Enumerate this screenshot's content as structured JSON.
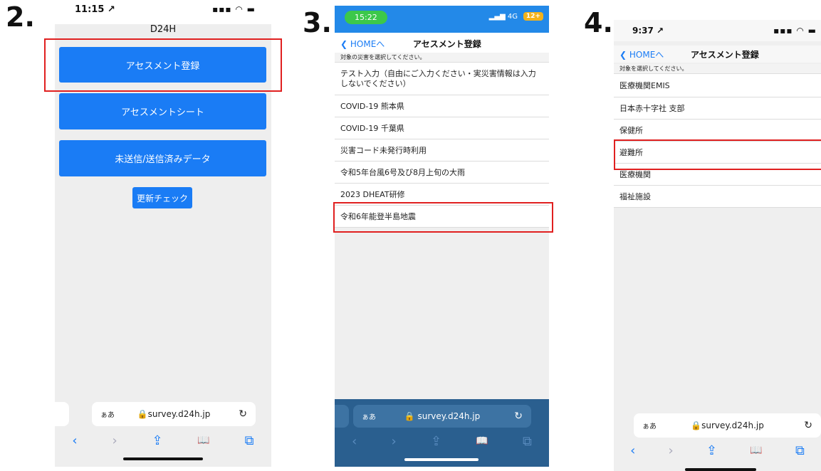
{
  "steps": [
    "2.",
    "3.",
    "4."
  ],
  "screen2": {
    "time": "11:15 ↗",
    "status_icons": "▪▪▪ ◠ ▬",
    "title": "D24H",
    "buttons": [
      "アセスメント登録",
      "アセスメントシート",
      "未送信/送信済みデータ"
    ],
    "update_button": "更新チェック",
    "url_aa": "ぁあ",
    "url": "🔒survey.d24h.jp",
    "reload": "↻",
    "toolbar": [
      "‹",
      "›",
      "⇪",
      "📖",
      "⧉"
    ]
  },
  "screen3": {
    "time": "15:22",
    "status_icons": "▂▄▆ 4G",
    "battery": "12+",
    "back": "❮ HOMEへ",
    "title": "アセスメント登録",
    "hint": "対象の災害を選択してください。",
    "items": [
      "テスト入力（自由にご入力ください・実災害情報は入力しないでください）",
      "COVID-19 熊本県",
      "COVID-19 千葉県",
      "災害コード未発行時利用",
      "令和5年台風6号及び8月上旬の大雨",
      "2023 DHEAT研修",
      "令和6年能登半島地震"
    ],
    "url_aa": "ぁあ",
    "url": "🔒 survey.d24h.jp",
    "reload": "↻",
    "toolbar": [
      "‹",
      "›",
      "⇪",
      "📖",
      "⧉"
    ]
  },
  "screen4": {
    "time": "9:37 ↗",
    "status_icons": "▪▪▪ ◠ ▬",
    "back": "❮ HOMEへ",
    "title": "アセスメント登録",
    "hint": "対象を選択してください。",
    "items": [
      "医療機関EMIS",
      "日本赤十字社 支部",
      "保健所",
      "避難所",
      "医療機関",
      "福祉施設"
    ],
    "url_aa": "ぁあ",
    "url": "🔒survey.d24h.jp",
    "reload": "↻",
    "toolbar": [
      "‹",
      "›",
      "⇪",
      "📖",
      "⧉"
    ]
  },
  "colors": {
    "accent": "#1a7cf5",
    "highlight": "#e02020",
    "dark_toolbar": "#2a5f8f"
  }
}
